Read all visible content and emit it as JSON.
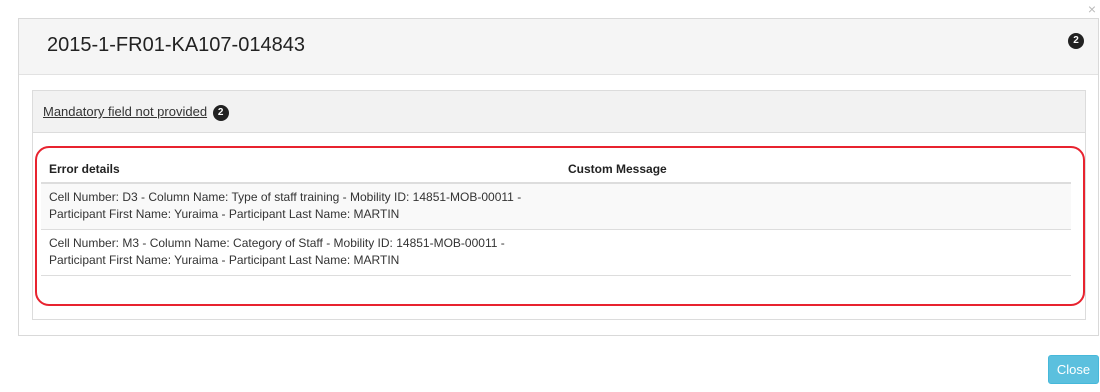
{
  "modal": {
    "title": "2015-1-FR01-KA107-014843",
    "header_badge_count": "2",
    "close_x": "×"
  },
  "panel": {
    "heading": "Mandatory field not provided",
    "badge_count": "2"
  },
  "table": {
    "headers": [
      "Error details",
      "Custom Message"
    ],
    "rows": [
      {
        "details": "Cell Number: D3 - Column Name: Type of staff training - Mobility ID: 14851-MOB-00011 - Participant First Name: Yuraima - Participant Last Name: MARTIN",
        "custom_message": ""
      },
      {
        "details": "Cell Number: M3 - Column Name: Category of Staff - Mobility ID: 14851-MOB-00011 - Participant First Name: Yuraima - Participant Last Name: MARTIN",
        "custom_message": ""
      }
    ]
  },
  "footer": {
    "close_label": "Close"
  },
  "colors": {
    "highlight_border": "#e8232f",
    "close_button_bg": "#5bc0de",
    "badge_bg": "#222222"
  }
}
